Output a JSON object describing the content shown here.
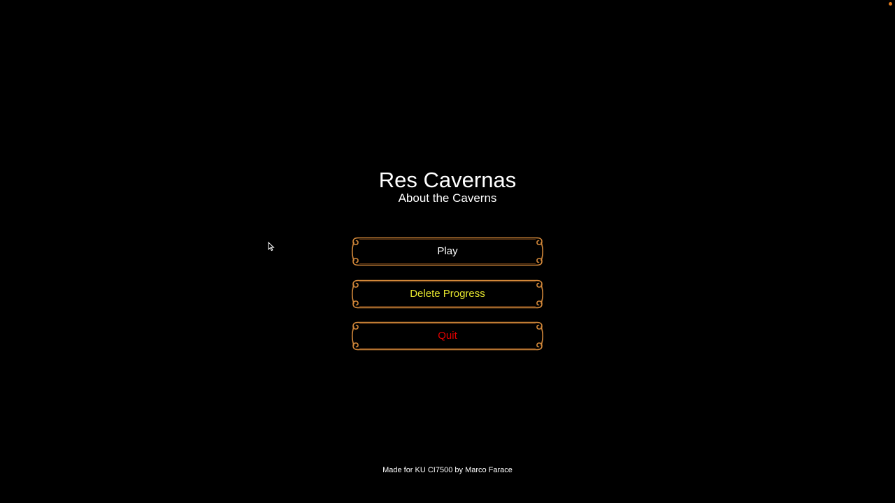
{
  "title": "Res Cavernas",
  "subtitle": "About the Caverns",
  "menu": {
    "play_label": "Play",
    "delete_label": "Delete Progress",
    "quit_label": "Quit"
  },
  "credits": "Made for KU CI7500 by Marco Farace",
  "colors": {
    "background": "#000000",
    "frame": "#d4893a",
    "play_text": "#ffffff",
    "delete_text": "#e6e62e",
    "quit_text": "#e00000",
    "indicator": "#e07a1c"
  },
  "icons": {
    "cursor": "mouse-pointer-icon",
    "indicator": "status-dot-icon"
  }
}
